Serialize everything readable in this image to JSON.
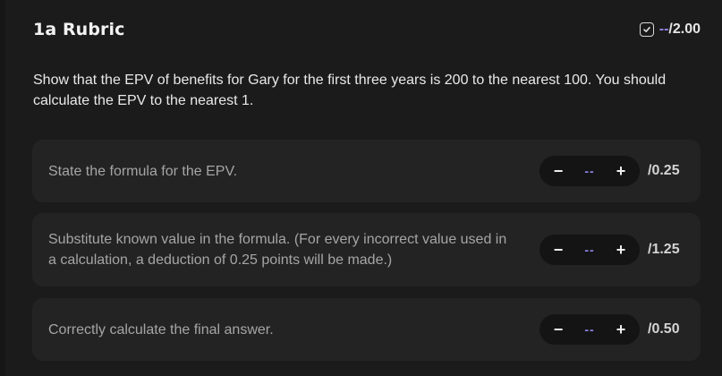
{
  "header": {
    "title": "1a Rubric",
    "score_value": "--",
    "score_total": "/2.00"
  },
  "prompt": "Show that the EPV of benefits for Gary for the first three years is 200 to the nearest 100. You should calculate the EPV to the nearest 1.",
  "criteria": [
    {
      "text": "State the formula for the EPV.",
      "minus": "−",
      "value": "--",
      "plus": "+",
      "max": "/0.25"
    },
    {
      "text": "Substitute known value in the formula. (For every incorrect value used in a calculation, a deduction of 0.25 points will be made.)",
      "minus": "−",
      "value": "--",
      "plus": "+",
      "max": "/1.25"
    },
    {
      "text": "Correctly calculate the final answer.",
      "minus": "−",
      "value": "--",
      "plus": "+",
      "max": "/0.50"
    }
  ],
  "colors": {
    "background": "#1b1b1c",
    "card": "#232324",
    "stepper": "#141415",
    "accent": "#8f86e6"
  },
  "icons": {
    "score": "checkbox-check-icon"
  }
}
